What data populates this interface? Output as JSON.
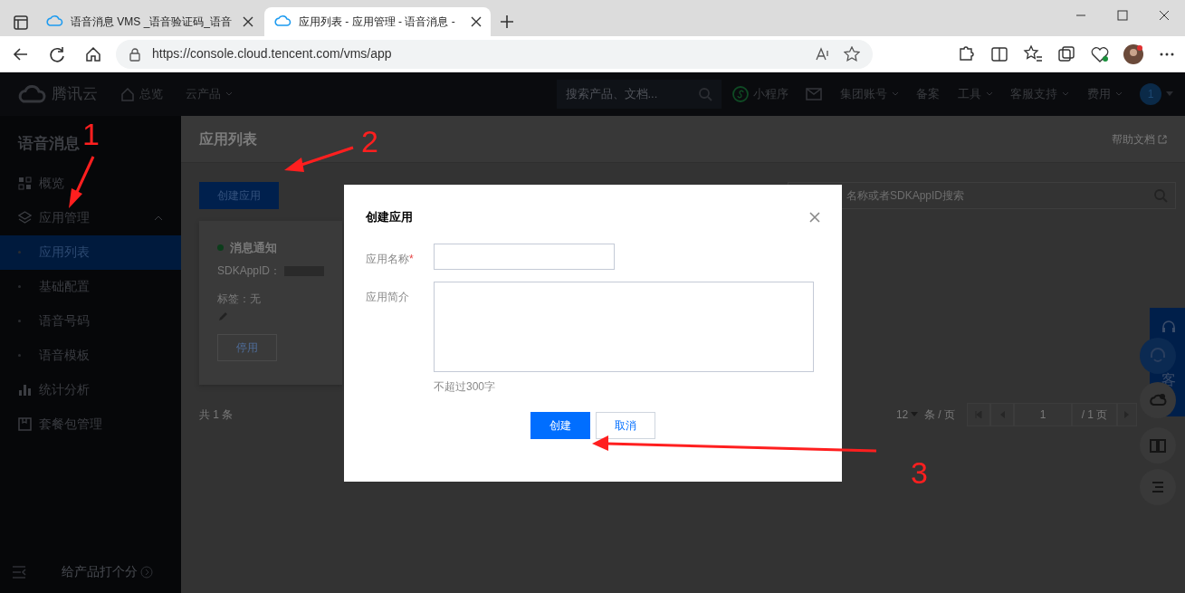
{
  "browser": {
    "tabs": [
      {
        "title": "语音消息 VMS _语音验证码_语音",
        "selected": false
      },
      {
        "title": "应用列表 - 应用管理 - 语音消息 -",
        "selected": true
      }
    ],
    "url": "https://console.cloud.tencent.com/vms/app"
  },
  "topnav": {
    "brand": "腾讯云",
    "items": [
      {
        "label": "总览",
        "kind": "home"
      },
      {
        "label": "云产品",
        "kind": "dropdown"
      }
    ],
    "search_placeholder": "搜索产品、文档...",
    "right_items": [
      {
        "label": "小程序",
        "kind": "miniapp"
      },
      {
        "kind": "mail"
      },
      {
        "label": "集团账号",
        "kind": "dropdown"
      },
      {
        "label": "备案",
        "kind": "plain"
      },
      {
        "label": "工具",
        "kind": "dropdown"
      },
      {
        "label": "客服支持",
        "kind": "dropdown"
      },
      {
        "label": "费用",
        "kind": "dropdown"
      }
    ],
    "avatar": "1"
  },
  "sidebar": {
    "title": "语音消息",
    "items": [
      {
        "label": "概览",
        "kind": "link",
        "selected": false
      },
      {
        "label": "应用管理",
        "kind": "group",
        "selected": false,
        "expanded": true,
        "children": [
          {
            "label": "应用列表",
            "selected": true
          },
          {
            "label": "基础配置",
            "selected": false
          },
          {
            "label": "语音号码",
            "selected": false
          },
          {
            "label": "语音模板",
            "selected": false
          }
        ]
      },
      {
        "label": "统计分析",
        "kind": "link",
        "selected": false
      },
      {
        "label": "套餐包管理",
        "kind": "link",
        "selected": false
      }
    ],
    "rate": "给产品打个分"
  },
  "page": {
    "title": "应用列表",
    "help": "帮助文档",
    "create_button": "创建应用",
    "search_placeholder": "名称或者SDKAppID搜索",
    "apps": [
      {
        "name": "消息通知",
        "enabled": true,
        "sdkappid_label": "SDKAppID：",
        "tags": "标签：无",
        "action": "停用"
      }
    ],
    "total": "共 1 条",
    "pagination": {
      "page_size": "12",
      "per_page": "条 / 页",
      "page": "1",
      "pages": "/ 1 页"
    }
  },
  "dialog": {
    "title": "创建应用",
    "required_mark": "*",
    "fields": [
      {
        "label": "应用名称",
        "required": true,
        "kind": "input"
      },
      {
        "label": "应用简介",
        "required": false,
        "kind": "textarea",
        "hint": "不超过300字"
      }
    ],
    "buttons": [
      {
        "label": "创建",
        "primary": true
      },
      {
        "label": "取消",
        "primary": false
      }
    ]
  },
  "float_panel": {
    "text": "客"
  },
  "annotations": [
    "1",
    "2",
    "3"
  ]
}
